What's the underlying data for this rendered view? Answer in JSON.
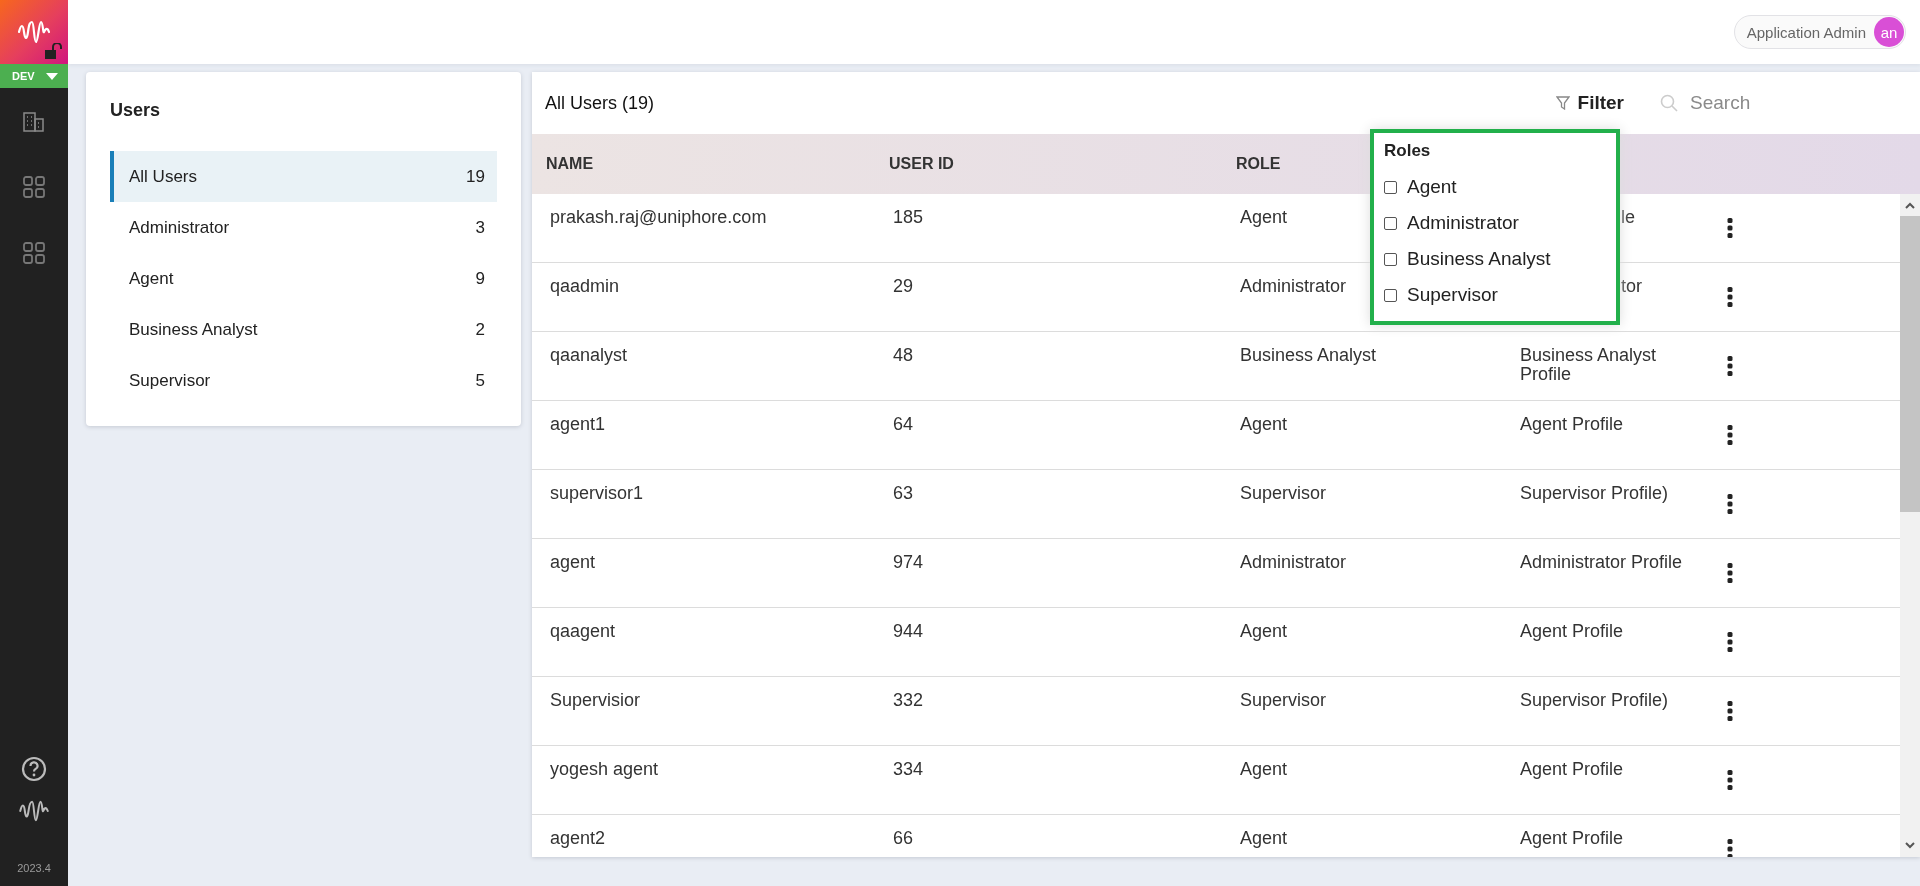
{
  "rail": {
    "env": "DEV",
    "version": "2023.4"
  },
  "header": {
    "user": "Application Admin",
    "initials": "an"
  },
  "users_panel": {
    "title": "Users",
    "items": [
      {
        "label": "All Users",
        "count": "19",
        "selected": true
      },
      {
        "label": "Administrator",
        "count": "3",
        "selected": false
      },
      {
        "label": "Agent",
        "count": "9",
        "selected": false
      },
      {
        "label": "Business Analyst",
        "count": "2",
        "selected": false
      },
      {
        "label": "Supervisor",
        "count": "5",
        "selected": false
      }
    ]
  },
  "table": {
    "title": "All Users (19)",
    "filter": "Filter",
    "search": {
      "placeholder": "Search"
    },
    "columns": [
      "NAME",
      "USER ID",
      "ROLE"
    ],
    "rows": [
      {
        "name": "prakash.raj@uniphore.com",
        "user_id": "185",
        "role": "Agent",
        "profile": "le",
        "covered": true
      },
      {
        "name": "qaadmin",
        "user_id": "29",
        "role": "Administrator",
        "profile": "tor",
        "covered": true
      },
      {
        "name": "qaanalyst",
        "user_id": "48",
        "role": "Business Analyst",
        "profile": "Business Analyst Profile"
      },
      {
        "name": "agent1",
        "user_id": "64",
        "role": "Agent",
        "profile": "Agent Profile"
      },
      {
        "name": "supervisor1",
        "user_id": "63",
        "role": "Supervisor",
        "profile": "Supervisor Profile)"
      },
      {
        "name": "agent",
        "user_id": "974",
        "role": "Administrator",
        "profile": "Administrator Profile"
      },
      {
        "name": "qaagent",
        "user_id": "944",
        "role": "Agent",
        "profile": "Agent Profile"
      },
      {
        "name": "Supervisior",
        "user_id": "332",
        "role": "Supervisor",
        "profile": "Supervisor Profile)"
      },
      {
        "name": "yogesh agent",
        "user_id": "334",
        "role": "Agent",
        "profile": "Agent Profile"
      },
      {
        "name": "agent2",
        "user_id": "66",
        "role": "Agent",
        "profile": "Agent Profile"
      }
    ]
  },
  "roles_filter": {
    "title": "Roles",
    "options": [
      {
        "label": "Agent",
        "checked": false
      },
      {
        "label": "Administrator",
        "checked": false
      },
      {
        "label": "Business Analyst",
        "checked": false
      },
      {
        "label": "Supervisor",
        "checked": false
      }
    ]
  }
}
